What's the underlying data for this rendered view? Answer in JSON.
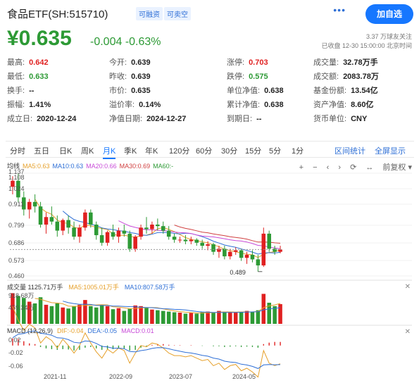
{
  "header": {
    "title": "食品ETF(SH:515710)",
    "tags": [
      "可融资",
      "可卖空"
    ],
    "more": "•••",
    "add_label": "加自选"
  },
  "quote": {
    "price": "¥0.635",
    "change": "-0.004",
    "change_pct": "-0.63%",
    "followers": "3.37 万球友关注",
    "status": "已收盘 12-30 15:00:00 北京时间"
  },
  "stats": [
    [
      {
        "k": "最高:",
        "v": "0.642",
        "c": "red"
      },
      {
        "k": "今开:",
        "v": "0.639",
        "c": ""
      },
      {
        "k": "涨停:",
        "v": "0.703",
        "c": "red"
      },
      {
        "k": "成交量:",
        "v": "32.78万手",
        "c": ""
      }
    ],
    [
      {
        "k": "最低:",
        "v": "0.633",
        "c": "green"
      },
      {
        "k": "昨收:",
        "v": "0.639",
        "c": ""
      },
      {
        "k": "跌停:",
        "v": "0.575",
        "c": "green"
      },
      {
        "k": "成交额:",
        "v": "2083.78万",
        "c": ""
      }
    ],
    [
      {
        "k": "换手:",
        "v": "--",
        "c": ""
      },
      {
        "k": "市价:",
        "v": "0.635",
        "c": ""
      },
      {
        "k": "单位净值:",
        "v": "0.638",
        "c": ""
      },
      {
        "k": "基金份额:",
        "v": "13.54亿",
        "c": ""
      }
    ],
    [
      {
        "k": "振幅:",
        "v": "1.41%",
        "c": ""
      },
      {
        "k": "溢价率:",
        "v": "0.14%",
        "c": ""
      },
      {
        "k": "累计净值:",
        "v": "0.638",
        "c": ""
      },
      {
        "k": "资产净值:",
        "v": "8.60亿",
        "c": ""
      }
    ],
    [
      {
        "k": "成立日:",
        "v": "2020-12-24",
        "c": ""
      },
      {
        "k": "净值日期:",
        "v": "2024-12-27",
        "c": ""
      },
      {
        "k": "到期日:",
        "v": "--",
        "c": ""
      },
      {
        "k": "货币单位:",
        "v": "CNY",
        "c": ""
      }
    ]
  ],
  "tabs": [
    "分时",
    "五日",
    "日K",
    "周K",
    "月K",
    "季K",
    "年K",
    "120分",
    "60分",
    "30分",
    "15分",
    "5分",
    "1分"
  ],
  "active_tab": "月K",
  "tabs_right": [
    "区间统计",
    "全屏显示"
  ],
  "toolbar": {
    "icons": [
      "+",
      "−",
      "‹",
      "›",
      "⟳",
      "↔"
    ],
    "adjust": "前复权"
  },
  "price_chart": {
    "legend": [
      {
        "text": "均线",
        "color": "#333333"
      },
      {
        "text": "MA5:0.63",
        "color": "#e6a02a"
      },
      {
        "text": "MA10:0.63",
        "color": "#2e6fd6"
      },
      {
        "text": "MA20:0.66",
        "color": "#c84bd8"
      },
      {
        "text": "MA30:0.69",
        "color": "#d04040"
      },
      {
        "text": "MA60:-",
        "color": "#2d9a35"
      }
    ],
    "y_ticks": [
      "1.137",
      "1.108",
      "1.024",
      "0.911",
      "0.799",
      "0.686",
      "0.573",
      "0.460"
    ],
    "low_label": "0.489"
  },
  "volume_chart": {
    "legend": [
      {
        "text": "成交量 1125.71万手",
        "color": "#333333"
      },
      {
        "text": "MA5:1005.01万手",
        "color": "#e6a02a"
      },
      {
        "text": "MA10:807.58万手",
        "color": "#2e6fd6"
      }
    ],
    "y_ticks": [
      "918.68万",
      "459.34万"
    ],
    "close": "✕"
  },
  "macd_chart": {
    "legend": [
      {
        "text": "MACD (12,26,9)",
        "color": "#333333"
      },
      {
        "text": "DIF:-0.04",
        "color": "#e6a02a"
      },
      {
        "text": "DEA:-0.05",
        "color": "#2e6fd6"
      },
      {
        "text": "MACD:0.01",
        "color": "#c84bd8"
      }
    ],
    "y_ticks": [
      "0.02",
      "-0.02",
      "-0.06"
    ],
    "x_ticks": [
      "2021-11",
      "2022-09",
      "2023-07",
      "2024-05"
    ],
    "close": "✕"
  },
  "colors": {
    "up": "#e02020",
    "down": "#2d9a35",
    "accent": "#1677ff"
  },
  "chart_data": {
    "type": "candlestick",
    "period": "monthly",
    "ohlc": [
      [
        1.05,
        1.12,
        1.0,
        1.09
      ],
      [
        1.09,
        1.137,
        0.95,
        0.98
      ],
      [
        0.98,
        1.02,
        0.86,
        0.9
      ],
      [
        0.9,
        0.97,
        0.84,
        0.95
      ],
      [
        0.95,
        1.0,
        0.88,
        0.92
      ],
      [
        0.92,
        0.95,
        0.78,
        0.8
      ],
      [
        0.8,
        0.88,
        0.74,
        0.85
      ],
      [
        0.85,
        0.92,
        0.8,
        0.82
      ],
      [
        0.82,
        0.86,
        0.72,
        0.76
      ],
      [
        0.76,
        0.84,
        0.73,
        0.83
      ],
      [
        0.83,
        0.86,
        0.74,
        0.78
      ],
      [
        0.78,
        0.82,
        0.7,
        0.72
      ],
      [
        0.72,
        0.8,
        0.68,
        0.78
      ],
      [
        0.78,
        0.9,
        0.76,
        0.88
      ],
      [
        0.88,
        0.9,
        0.78,
        0.8
      ],
      [
        0.8,
        0.82,
        0.7,
        0.73
      ],
      [
        0.73,
        0.78,
        0.66,
        0.68
      ],
      [
        0.68,
        0.76,
        0.66,
        0.75
      ],
      [
        0.75,
        0.8,
        0.7,
        0.72
      ],
      [
        0.72,
        0.78,
        0.68,
        0.76
      ],
      [
        0.76,
        0.8,
        0.72,
        0.74
      ],
      [
        0.74,
        0.76,
        0.62,
        0.64
      ],
      [
        0.64,
        0.73,
        0.62,
        0.72
      ],
      [
        0.72,
        0.8,
        0.7,
        0.78
      ],
      [
        0.78,
        0.85,
        0.74,
        0.77
      ],
      [
        0.77,
        0.82,
        0.74,
        0.8
      ],
      [
        0.8,
        0.84,
        0.76,
        0.79
      ],
      [
        0.79,
        0.82,
        0.74,
        0.76
      ],
      [
        0.76,
        0.79,
        0.7,
        0.72
      ],
      [
        0.72,
        0.74,
        0.68,
        0.7
      ],
      [
        0.7,
        0.72,
        0.68,
        0.7
      ],
      [
        0.7,
        0.73,
        0.67,
        0.69
      ],
      [
        0.69,
        0.72,
        0.67,
        0.7
      ],
      [
        0.7,
        0.71,
        0.66,
        0.68
      ],
      [
        0.68,
        0.7,
        0.64,
        0.66
      ],
      [
        0.66,
        0.69,
        0.63,
        0.67
      ],
      [
        0.67,
        0.68,
        0.6,
        0.62
      ],
      [
        0.62,
        0.66,
        0.58,
        0.64
      ],
      [
        0.64,
        0.66,
        0.57,
        0.59
      ],
      [
        0.59,
        0.64,
        0.57,
        0.62
      ],
      [
        0.62,
        0.65,
        0.6,
        0.63
      ],
      [
        0.63,
        0.64,
        0.56,
        0.58
      ],
      [
        0.58,
        0.62,
        0.54,
        0.6
      ],
      [
        0.6,
        0.63,
        0.55,
        0.57
      ],
      [
        0.57,
        0.6,
        0.489,
        0.53
      ],
      [
        0.53,
        0.78,
        0.52,
        0.74
      ],
      [
        0.74,
        0.76,
        0.62,
        0.64
      ],
      [
        0.64,
        0.66,
        0.6,
        0.62
      ],
      [
        0.62,
        0.66,
        0.61,
        0.635
      ]
    ],
    "volume": [
      900,
      820,
      760,
      650,
      600,
      780,
      560,
      520,
      600,
      480,
      450,
      520,
      560,
      700,
      520,
      480,
      560,
      520,
      430,
      460,
      380,
      440,
      540,
      520,
      480,
      420,
      400,
      380,
      360,
      340,
      330,
      300,
      320,
      300,
      340,
      360,
      320,
      380,
      360,
      340,
      330,
      350,
      380,
      360,
      400,
      880,
      620,
      520,
      580
    ],
    "macd": [
      0.02,
      0.018,
      0.012,
      0.006,
      0.004,
      -0.004,
      -0.008,
      -0.01,
      -0.012,
      -0.01,
      -0.011,
      -0.014,
      -0.012,
      -0.006,
      -0.004,
      -0.008,
      -0.012,
      -0.01,
      -0.01,
      -0.008,
      -0.008,
      -0.014,
      -0.012,
      -0.006,
      -0.002,
      0.002,
      0.004,
      0.004,
      0.002,
      0.001,
      0.001,
      0.0,
      0.001,
      0.0,
      -0.001,
      0.0,
      -0.002,
      -0.002,
      -0.004,
      -0.003,
      -0.002,
      -0.004,
      -0.003,
      -0.004,
      -0.006,
      0.004,
      0.008,
      0.01,
      0.01
    ]
  }
}
